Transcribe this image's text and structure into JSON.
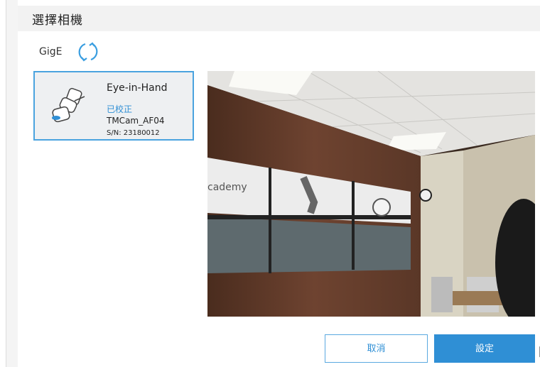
{
  "dialog": {
    "title": "選擇相機"
  },
  "connection": {
    "label": "GigE",
    "refresh_icon": "refresh-icon"
  },
  "camera": {
    "name": "Eye-in-Hand",
    "status": "已校正",
    "model": "TMCam_AF04",
    "serial": "S/N: 23180012",
    "icon": "robot-camera-icon"
  },
  "preview": {
    "sign_text": "cademy"
  },
  "buttons": {
    "cancel": "取消",
    "set": "設定"
  },
  "colors": {
    "accent": "#2f8fd5",
    "selection_border": "#4aa3df"
  }
}
